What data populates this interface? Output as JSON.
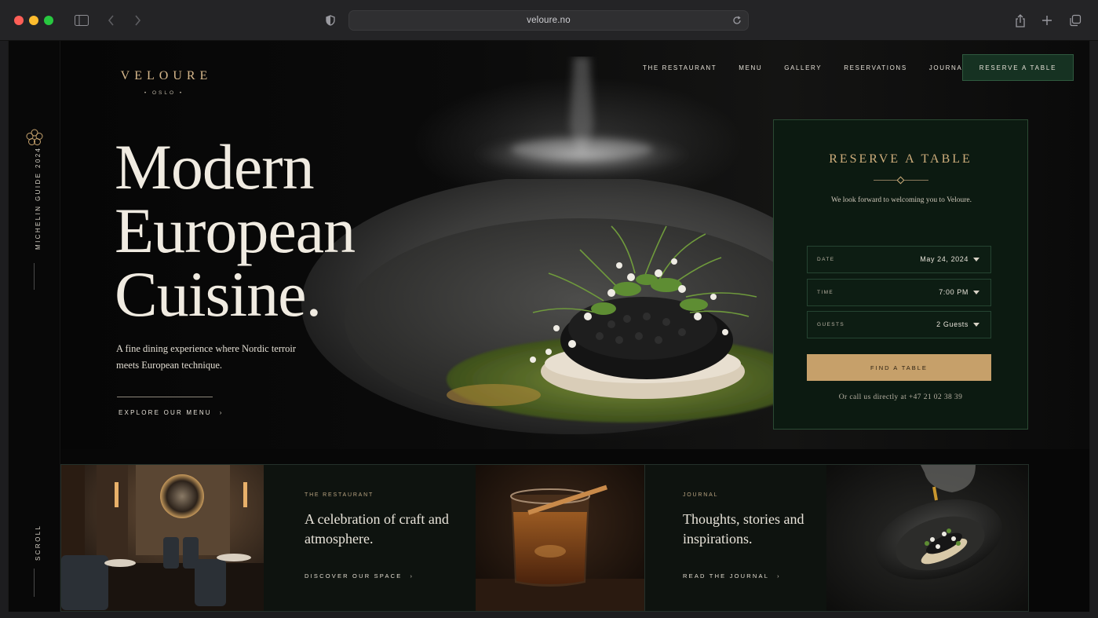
{
  "browser": {
    "url": "veloure.no"
  },
  "brand": {
    "name": "VELOURE",
    "city": "• OSLO •"
  },
  "nav": {
    "items": [
      "THE RESTAURANT",
      "MENU",
      "GALLERY",
      "RESERVATIONS",
      "JOURNAL"
    ],
    "cta": "RESERVE A TABLE"
  },
  "rail": {
    "badge": "MICHELIN GUIDE 2024",
    "scroll": "SCROLL"
  },
  "hero": {
    "headline_lines": [
      "Modern",
      "European",
      "Cuisine."
    ],
    "tagline": "A fine dining experience where Nordic terroir meets European technique.",
    "link": "EXPLORE OUR MENU"
  },
  "reservation": {
    "title": "RESERVE A TABLE",
    "intro": "We look forward to welcoming you to Veloure.",
    "fields": [
      {
        "label": "DATE",
        "value": "May 24, 2024"
      },
      {
        "label": "TIME",
        "value": "7:00 PM"
      },
      {
        "label": "GUESTS",
        "value": "2 Guests"
      }
    ],
    "button": "FIND A TABLE",
    "call": "Or call us directly at +47 21 02 38 39"
  },
  "features": [
    {
      "eyebrow": "THE RESTAURANT",
      "heading": "A celebration of craft and atmosphere.",
      "link": "DISCOVER OUR SPACE"
    },
    {
      "eyebrow": "JOURNAL",
      "heading": "Thoughts, stories and inspirations.",
      "link": "READ THE JOURNAL"
    }
  ],
  "colors": {
    "accent_gold": "#c6a06a",
    "forest_green": "#0c1a11",
    "background": "#070707"
  }
}
